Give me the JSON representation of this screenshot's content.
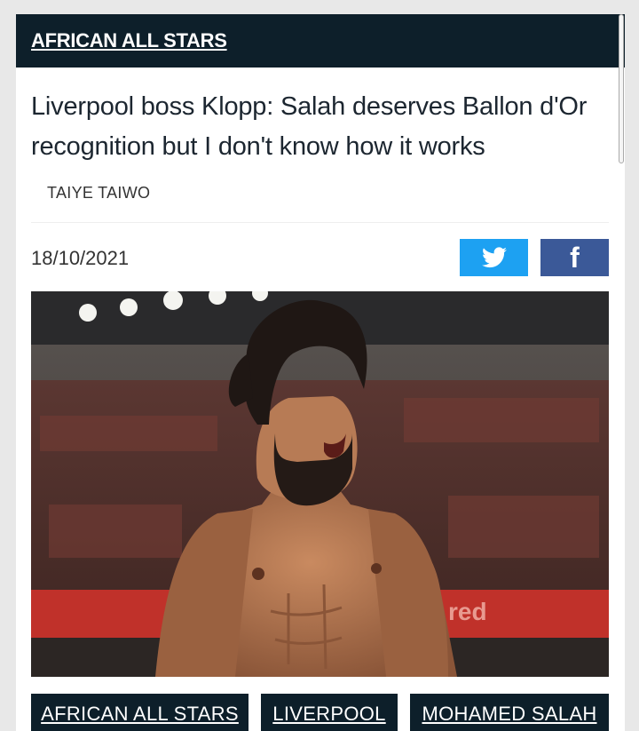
{
  "category": {
    "label": "AFRICAN ALL STARS"
  },
  "article": {
    "headline": "Liverpool boss Klopp: Salah deserves Ballon d'Or recognition but I don't know how it works",
    "author": "TAIYE TAIWO",
    "date": "18/10/2021"
  },
  "share": {
    "twitter_icon": "twitter-bird-icon",
    "facebook_icon": "facebook-f-icon",
    "twitter_color": "#1da1f2",
    "facebook_color": "#3b5998"
  },
  "hero_image": {
    "banner_text": "red"
  },
  "tags": [
    "AFRICAN ALL STARS",
    "LIVERPOOL",
    "MOHAMED SALAH"
  ],
  "colors": {
    "header_bg": "#0d1f2a",
    "page_bg": "#e8e8e8"
  }
}
